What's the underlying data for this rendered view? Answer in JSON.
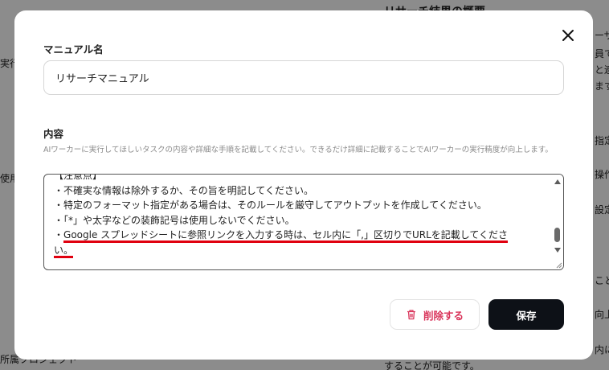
{
  "background": {
    "heading": "リサーチ結果の概要",
    "left_fragments": [
      "実行",
      "使用",
      "所属プロジェクト"
    ],
    "right_fragments": [
      "ーザ",
      "員て",
      "と連携",
      "ます",
      "指定",
      "操作",
      "設定",
      "こと",
      "向上し",
      "内に"
    ],
    "bottom_text": "することが可能です。"
  },
  "modal": {
    "name_label": "マニュアル名",
    "name_value": "リサーチマニュアル",
    "content_label": "内容",
    "helper_text": "AIワーカーに実行してほしいタスクの内容や詳細な手順を記載してください。できるだけ詳細に記載することでAIワーカーの実行精度が向上します。",
    "content_lines": [
      "【注意点】",
      "・不確実な情報は除外するか、その旨を明記してください。",
      "・特定のフォーマット指定がある場合は、そのルールを厳守してアウトプットを作成してください。",
      "・「*」や太字などの装飾記号は使用しないでください。"
    ],
    "highlight_prefix": "・",
    "highlight_text": "Google スプレッドシートに参照リンクを入力する時は、セル内に「,」区切りでURLを記載してくださ",
    "highlight_tail": "い。",
    "delete_label": "削除する",
    "save_label": "保存"
  },
  "colors": {
    "accent_red": "#e0000f",
    "delete_text": "#d9345a",
    "save_bg": "#0d1117"
  }
}
